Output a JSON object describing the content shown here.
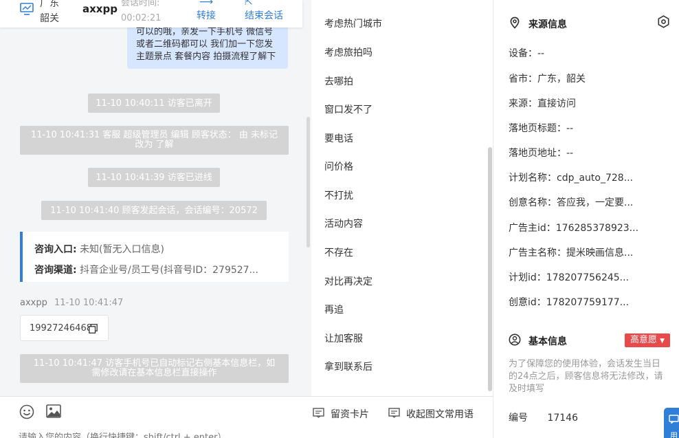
{
  "header": {
    "icon": "monitor-icon",
    "region": "广东韶关",
    "username": "axxpp",
    "session_time_label": "会话时间:",
    "session_time": "00:02:21",
    "transfer_label": "转接",
    "end_label": "结束会话"
  },
  "chat": {
    "outgoing_message": "可以的哦，亲发一下手机号 微信号或者二维码都可以 我们加一下您发主题景点 套餐内容 拍摄流程了解下",
    "system_messages": [
      "11-10 10:40:11 访客已离开",
      "11-10 10:41:31 客服 超级管理员 编辑 顾客状态： 由 未标记 改为 了解",
      "11-10 10:41:39 访客已进线",
      "11-10 10:41:40 顾客发起会话，会话编号：20572",
      "11-10 10:41:47 访客手机号已自动标记右侧基本信息栏，如需修改请在基本信息栏直接操作"
    ],
    "info_card": {
      "entry_label": "咨询入口:",
      "entry_value": "未知(暂无入口信息)",
      "channel_label": "咨询渠道:",
      "channel_value": "抖音企业号/员工号(抖音号ID：279527..."
    },
    "visitor_name": "axxpp",
    "visitor_time": "11-10 10:41:47",
    "phone": "19927246468"
  },
  "composer": {
    "emoji_icon": "emoji-icon",
    "image_icon": "image-icon",
    "card_label": "留资卡片",
    "collapse_label": "收起图文常用语",
    "placeholder": "请输入您的内容（换行快捷键：shift/ctrl + enter）"
  },
  "quick_replies": [
    "考虑热门城市",
    "考虑旅拍吗",
    "去哪拍",
    "窗口发不了",
    "要电话",
    "问价格",
    "不打扰",
    "活动内容",
    "不存在",
    "对比再决定",
    "再追",
    "让加客服",
    "拿到联系后"
  ],
  "source_info": {
    "title": "来源信息",
    "rows": [
      "设备：--",
      "省市：广东，韶关",
      "来源：直接访问",
      "落地页标题：--",
      "落地页地址：--",
      "计划名称：cdp_auto_728...",
      "创意名称：答应我，一定要...",
      "广告主id：176285378923...",
      "广告主名称：提米映画信息...",
      "计划id：178207756245...",
      "创意id：178207759177..."
    ]
  },
  "basic_info": {
    "title": "基本信息",
    "intent_badge": "高意愿",
    "notice": "为了保障您的使用体验，会话发生当日的24点之后，顾客信息将无法修改，请及时填写",
    "id_label": "编号",
    "id_value": "17146",
    "float_label": "用"
  },
  "colors": {
    "accent": "#2f7ed8",
    "badge_red": "#e8494b",
    "system_bubble": "#d4d4d4",
    "outgoing_bubble": "#d6e6ff"
  }
}
